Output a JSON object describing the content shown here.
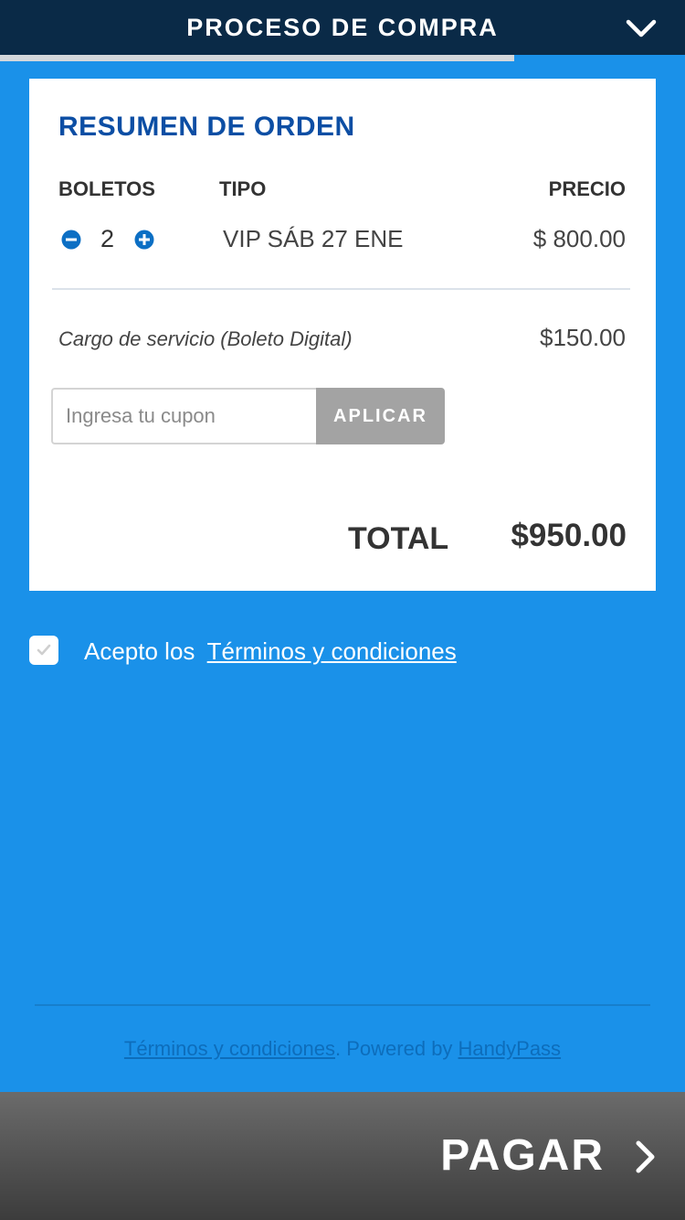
{
  "header": {
    "title": "PROCESO DE COMPRA",
    "toggle_icon": "chevron-down-icon"
  },
  "progress": {
    "fraction": 0.75
  },
  "order": {
    "heading": "RESUMEN DE ORDEN",
    "columns": {
      "boletos": "BOLETOS",
      "tipo": "TIPO",
      "precio": "PRECIO"
    },
    "item": {
      "quantity": "2",
      "type": "VIP SÁB 27 ENE",
      "price": "$ 800.00"
    },
    "service_fee": {
      "label": "Cargo de servicio (Boleto Digital)",
      "value": "$150.00"
    },
    "coupon": {
      "placeholder": "Ingresa tu cupon",
      "value": "",
      "button": "APLICAR"
    },
    "total": {
      "label": "TOTAL",
      "value": "$950.00"
    }
  },
  "terms": {
    "prefix": "Acepto los",
    "link": "Términos y condiciones",
    "checked": true
  },
  "footer": {
    "terms_link": "Términos y condiciones",
    "separator": ". Powered by ",
    "brand_link": "HandyPass"
  },
  "pay": {
    "label": "PAGAR",
    "icon": "chevron-right-icon"
  },
  "colors": {
    "background": "#1a91e9",
    "header": "#0a2a47",
    "heading": "#0c4ea4",
    "pay_bar": "#555555"
  }
}
